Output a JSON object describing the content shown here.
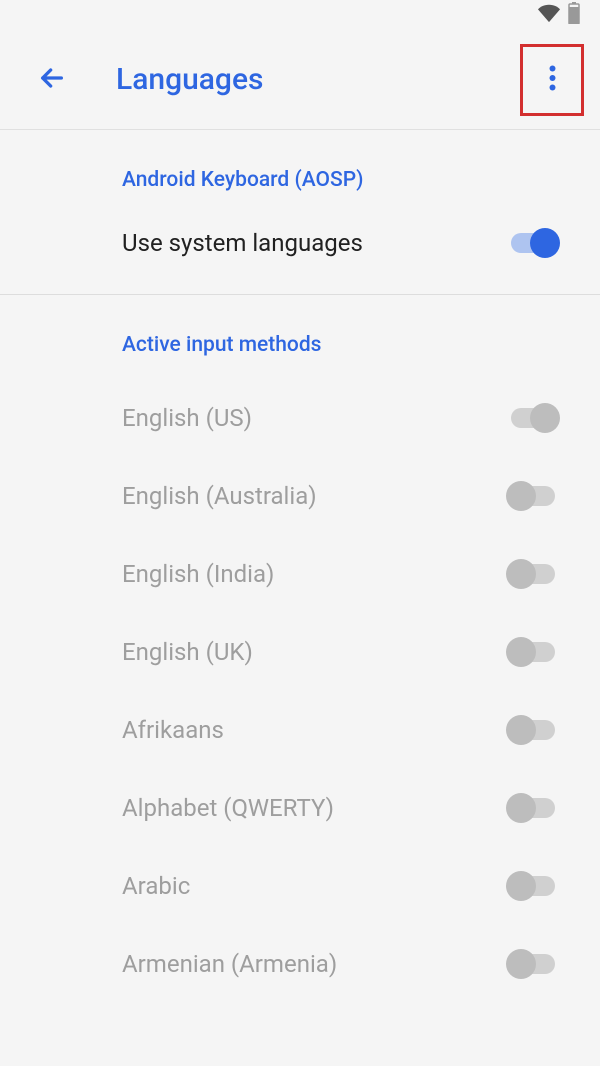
{
  "header": {
    "title": "Languages"
  },
  "sections": {
    "keyboard": {
      "title": "Android Keyboard (AOSP)",
      "system_languages_label": "Use system languages",
      "system_languages_on": true
    },
    "input_methods": {
      "title": "Active input methods",
      "languages": [
        {
          "label": "English (US)",
          "state": "off-right"
        },
        {
          "label": "English (Australia)",
          "state": "off-left"
        },
        {
          "label": "English (India)",
          "state": "off-left"
        },
        {
          "label": "English (UK)",
          "state": "off-left"
        },
        {
          "label": "Afrikaans",
          "state": "off-left"
        },
        {
          "label": "Alphabet (QWERTY)",
          "state": "off-left"
        },
        {
          "label": "Arabic",
          "state": "off-left"
        },
        {
          "label": "Armenian (Armenia)",
          "state": "off-left"
        }
      ]
    }
  },
  "colors": {
    "primary": "#2e66e1",
    "highlight_border": "#d32f2f",
    "disabled_text": "#9e9e9e"
  }
}
